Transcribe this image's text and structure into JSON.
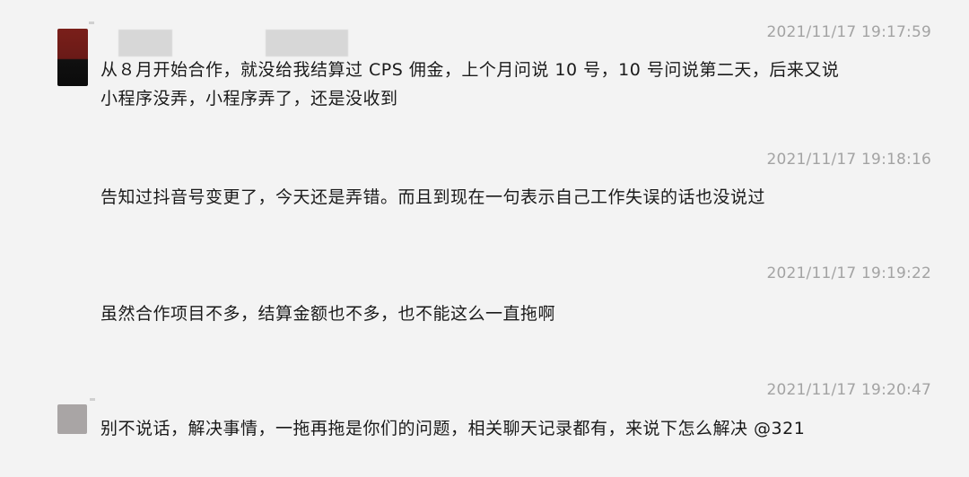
{
  "messages": [
    {
      "timestamp": "2021/11/17 19:17:59",
      "lines": [
        "从８月开始合作，就没给我结算过 CPS 佣金，上个月问说 10 号，10 号问说第二天，后来又说",
        "小程序没弄，小程序弄了，还是没收到"
      ]
    },
    {
      "timestamp": "2021/11/17 19:18:16",
      "lines": [
        "告知过抖音号变更了，今天还是弄错。而且到现在一句表示自己工作失误的话也没说过"
      ]
    },
    {
      "timestamp": "2021/11/17 19:19:22",
      "lines": [
        "虽然合作项目不多，结算金额也不多，也不能这么一直拖啊"
      ]
    },
    {
      "timestamp": "2021/11/17 19:20:47",
      "lines": [
        "别不说话，解决事情，一拖再拖是你们的问题，相关聊天记录都有，来说下怎么解决 @321"
      ]
    }
  ]
}
